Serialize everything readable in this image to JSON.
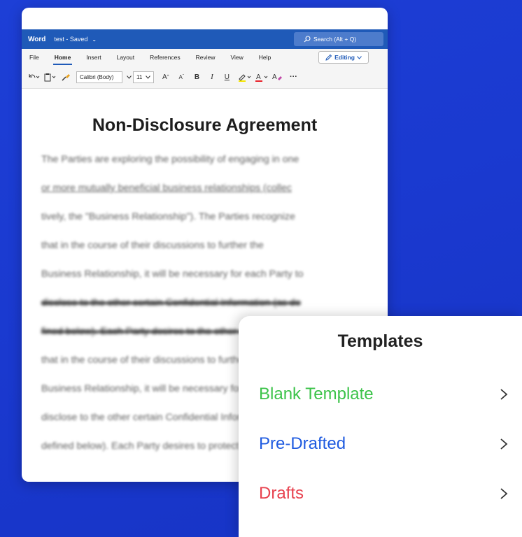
{
  "word": {
    "app_name": "Word",
    "doc_title": "test - Saved",
    "title_chevron": "⌄",
    "search_placeholder": "Search (Alt + Q)",
    "menu": [
      "File",
      "Home",
      "Insert",
      "Layout",
      "References",
      "Review",
      "View",
      "Help"
    ],
    "active_menu": "Home",
    "editing_label": "Editing",
    "toolbar": {
      "font_name": "Calibri (Body)",
      "font_size": "11",
      "grow_label": "A",
      "shrink_label": "A",
      "bold_label": "B",
      "italic_label": "I",
      "underline_label": "U",
      "more_label": "···"
    },
    "document": {
      "title": "Non-Disclosure Agreement",
      "lines": [
        "The Parties are exploring the possibility of engaging in one",
        "or more mutually beneficial business relationships (collec",
        "tively, the \"Business Relationship\"). The Parties recognize",
        "that in the course of their discussions to further the",
        "Business Relationship, it will be necessary for each Party to",
        "disclose to the other certain Confidential Information (as de",
        "fined below). Each Party desires to the other certain info",
        "that in the course of their discussions to further the",
        "Business Relationship, it will be necessary for each Party to",
        "disclose to the other certain Confidential Information (as",
        "defined below). Each Party desires to protect the other"
      ]
    }
  },
  "templates": {
    "title": "Templates",
    "items": [
      {
        "label": "Blank Template",
        "color": "#3cc34a"
      },
      {
        "label": "Pre-Drafted",
        "color": "#1f5be0"
      },
      {
        "label": "Drafts",
        "color": "#e8424f"
      }
    ]
  },
  "colors": {
    "background": "#1d3fd6",
    "word_blue": "#1f5ab8"
  }
}
